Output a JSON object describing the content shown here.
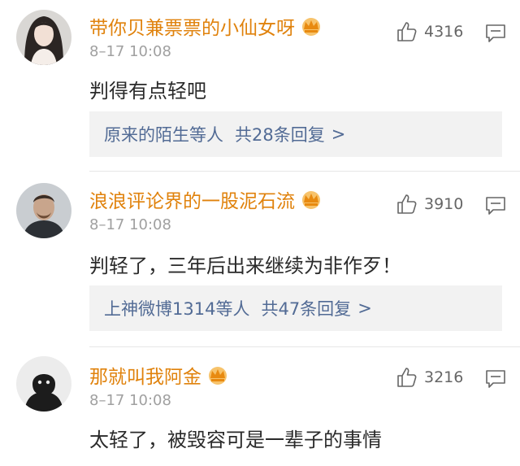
{
  "comments": [
    {
      "username": "带你贝兼票票的小仙女呀",
      "timestamp": "8–17 10:08",
      "text": "判得有点轻吧",
      "likes": "4316",
      "replies": {
        "users": "原来的陌生等人",
        "count_text": "共28条回复",
        "arrow": ">"
      },
      "avatar_icon": "female-avatar-icon",
      "badge_icon": "vip-crown-icon"
    },
    {
      "username": "浪浪评论界的一股泥石流",
      "timestamp": "8–17 10:08",
      "text": "判轻了，三年后出来继续为非作歹！",
      "likes": "3910",
      "replies": {
        "users": "上神微博1314等人",
        "count_text": "共47条回复",
        "arrow": ">"
      },
      "avatar_icon": "male-avatar-icon",
      "badge_icon": "vip-crown-icon"
    },
    {
      "username": "那就叫我阿金",
      "timestamp": "8–17 10:08",
      "text": "太轻了，被毁容可是一辈子的事情",
      "likes": "3216",
      "avatar_icon": "hooded-figure-avatar-icon",
      "badge_icon": "vip-crown-icon"
    }
  ],
  "icons": {
    "like": "thumbs-up-icon",
    "reply": "comment-bubble-icon"
  },
  "colors": {
    "username": "#e0820c",
    "reply_link": "#526b95",
    "timestamp": "#a0a0a0",
    "text": "#2a2a2a",
    "reply_box_bg": "#f2f2f2",
    "crown": "#f0a21b"
  }
}
